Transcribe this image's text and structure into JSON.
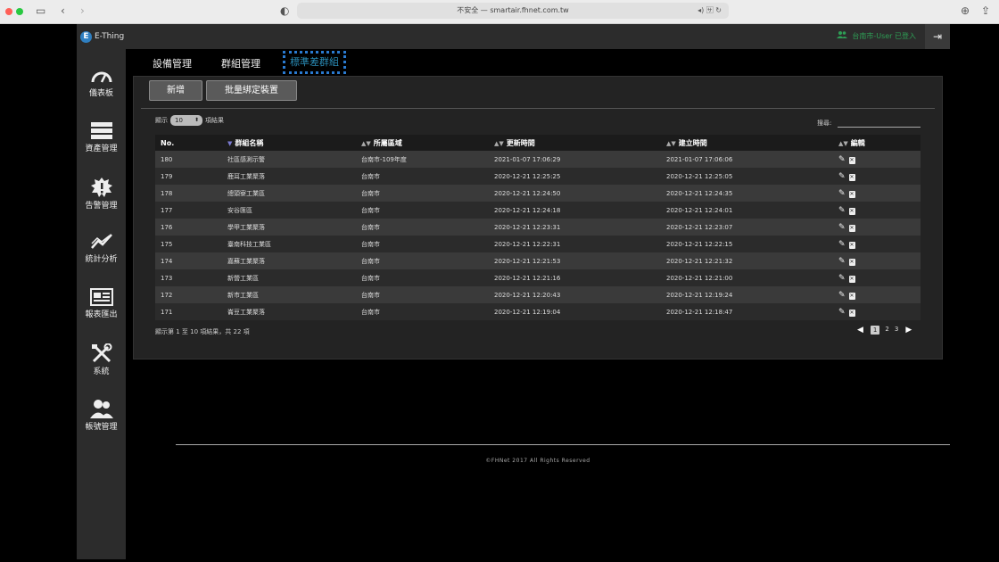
{
  "browser": {
    "url_text": "不安全 — smartair.fhnet.com.tw",
    "speaker": "◂) 🈂 ↻"
  },
  "brand": {
    "logo_letter": "E",
    "name": "E-Thing"
  },
  "header": {
    "user_text": "台南市-User 已登入"
  },
  "sidebar": {
    "items": [
      {
        "label": "儀表板",
        "icon": "gauge-icon"
      },
      {
        "label": "資產管理",
        "icon": "server-icon"
      },
      {
        "label": "告警管理",
        "icon": "alert-icon"
      },
      {
        "label": "統計分析",
        "icon": "chart-line-icon"
      },
      {
        "label": "報表匯出",
        "icon": "report-icon"
      },
      {
        "label": "系統",
        "icon": "tools-icon"
      },
      {
        "label": "帳號管理",
        "icon": "users-icon"
      }
    ]
  },
  "tabs": [
    {
      "label": "設備管理"
    },
    {
      "label": "群組管理"
    },
    {
      "label": "標準差群組"
    }
  ],
  "toolbar": {
    "add_label": "新增",
    "bind_label": "批量綁定裝置"
  },
  "length_control": {
    "prefix": "顯示",
    "value": "10",
    "suffix": "項結果"
  },
  "search": {
    "label": "搜尋:"
  },
  "table": {
    "columns": [
      "No.",
      "群組名稱",
      "所屬區域",
      "更新時間",
      "建立時間",
      "編輯"
    ],
    "rows": [
      [
        "180",
        "社區感測示警",
        "台南市-109年度",
        "2021-01-07 17:06:29",
        "2021-01-07 17:06:06"
      ],
      [
        "179",
        "鹿耳工業聚落",
        "台南市",
        "2020-12-21 12:25:25",
        "2020-12-21 12:25:05"
      ],
      [
        "178",
        "總頭寮工業區",
        "台南市",
        "2020-12-21 12:24:50",
        "2020-12-21 12:24:35"
      ],
      [
        "177",
        "安谷匯區",
        "台南市",
        "2020-12-21 12:24:18",
        "2020-12-21 12:24:01"
      ],
      [
        "176",
        "學甲工業聚落",
        "台南市",
        "2020-12-21 12:23:31",
        "2020-12-21 12:23:07"
      ],
      [
        "175",
        "臺南科技工業區",
        "台南市",
        "2020-12-21 12:22:31",
        "2020-12-21 12:22:15"
      ],
      [
        "174",
        "嘉蘇工業聚落",
        "台南市",
        "2020-12-21 12:21:53",
        "2020-12-21 12:21:32"
      ],
      [
        "173",
        "新營工業區",
        "台南市",
        "2020-12-21 12:21:16",
        "2020-12-21 12:21:00"
      ],
      [
        "172",
        "新市工業區",
        "台南市",
        "2020-12-21 12:20:43",
        "2020-12-21 12:19:24"
      ],
      [
        "171",
        "崙豆工業聚落",
        "台南市",
        "2020-12-21 12:19:04",
        "2020-12-21 12:18:47"
      ]
    ]
  },
  "table_info": "顯示第 1 至 10 項結果，共 22 項",
  "pagination": {
    "pages": [
      "1",
      "2",
      "3"
    ],
    "current": "1"
  },
  "footer": {
    "text": "©FHNet 2017 All Rights Reserved"
  },
  "colors": {
    "accent": "#2a8db8",
    "user_green": "#2e9e55",
    "sidebar_bg": "#2c2c2c"
  }
}
